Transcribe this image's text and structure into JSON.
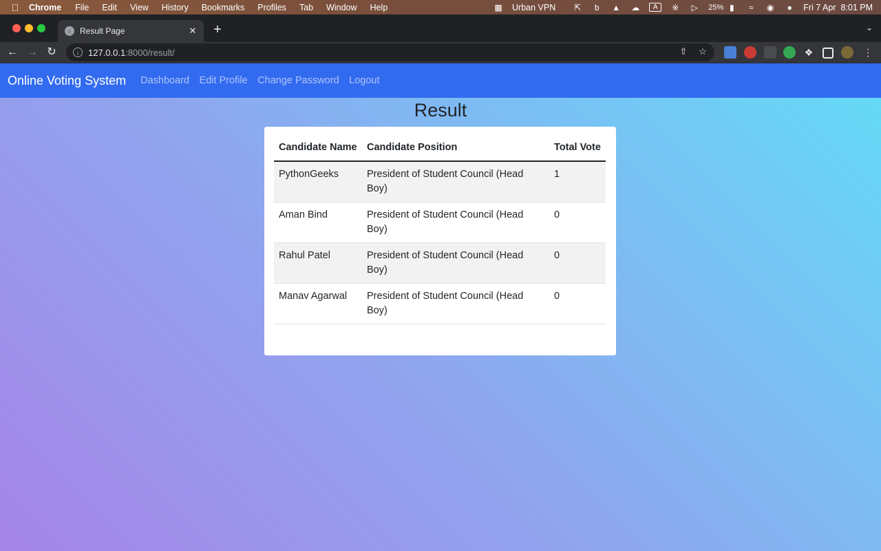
{
  "menubar": {
    "app": "Chrome",
    "items": [
      "File",
      "Edit",
      "View",
      "History",
      "Bookmarks",
      "Profiles",
      "Tab",
      "Window",
      "Help"
    ],
    "status": {
      "vpn": "Urban VPN",
      "keyboard": "A",
      "battery": "25%",
      "datetime": "Fri 7 Apr  8:01 PM"
    }
  },
  "browser": {
    "tab_title": "Result Page",
    "url_host": "127.0.0.1",
    "url_rest": ":8000/result/"
  },
  "navbar": {
    "brand": "Online Voting System",
    "links": [
      "Dashboard",
      "Edit Profile",
      "Change Password",
      "Logout"
    ]
  },
  "main": {
    "title": "Result",
    "table": {
      "headers": [
        "Candidate Name",
        "Candidate Position",
        "Total Vote"
      ],
      "rows": [
        [
          "PythonGeeks",
          "President of Student Council (Head Boy)",
          "1"
        ],
        [
          "Aman Bind",
          "President of Student Council (Head Boy)",
          "0"
        ],
        [
          "Rahul Patel",
          "President of Student Council (Head Boy)",
          "0"
        ],
        [
          "Manav Agarwal",
          "President of Student Council (Head Boy)",
          "0"
        ]
      ]
    }
  }
}
